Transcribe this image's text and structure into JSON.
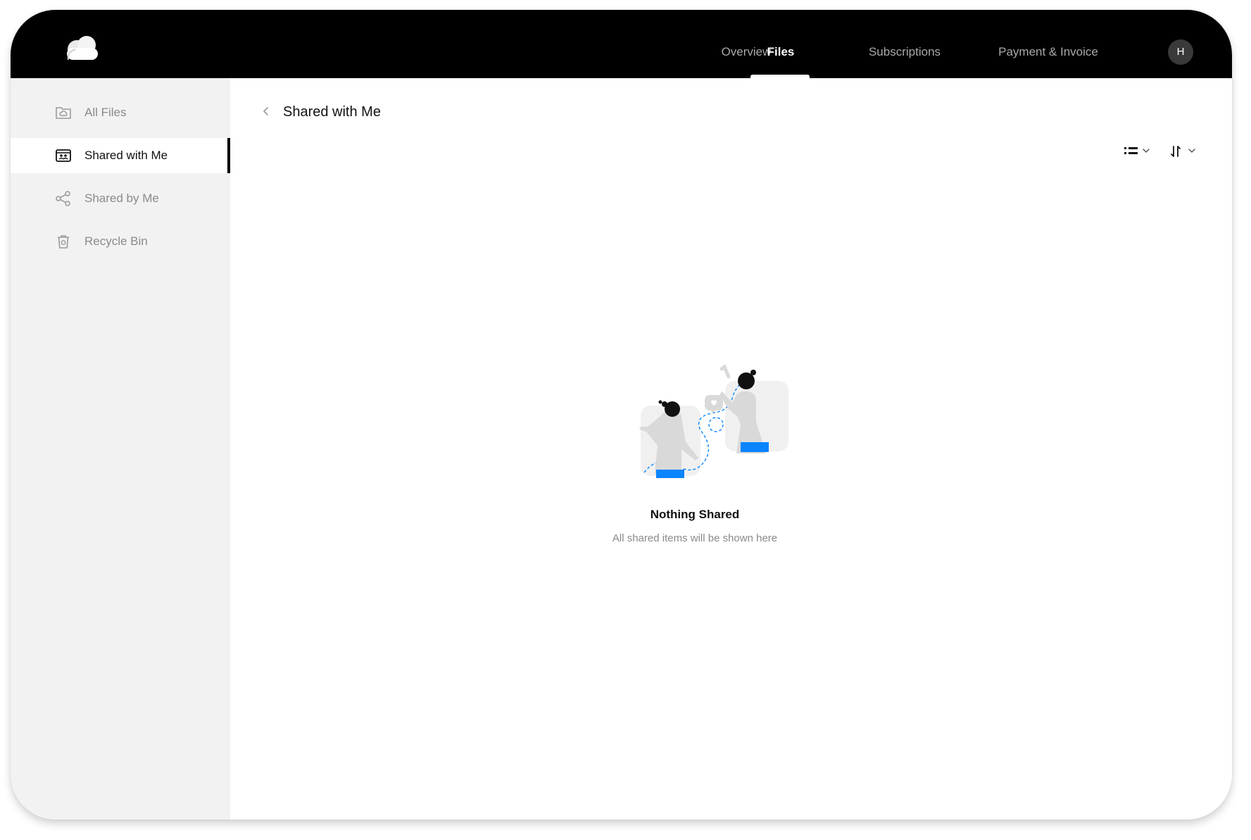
{
  "app": {
    "logo_icon": "cloud-icon"
  },
  "nav": {
    "tabs": [
      {
        "label": "Overview"
      },
      {
        "label": "Files"
      },
      {
        "label": "Subscriptions"
      },
      {
        "label": "Payment & Invoice"
      }
    ],
    "active_tab": "Files",
    "avatar_initial": "H"
  },
  "sidebar": {
    "items": [
      {
        "label": "All Files",
        "icon": "folder-cloud-icon"
      },
      {
        "label": "Shared with Me",
        "icon": "shared-with-me-icon"
      },
      {
        "label": "Shared by Me",
        "icon": "share-icon"
      },
      {
        "label": "Recycle Bin",
        "icon": "trash-icon"
      }
    ],
    "active_item": "Shared with Me"
  },
  "main": {
    "title": "Shared with Me",
    "back_icon": "chevron-left-icon",
    "view_toggle_icon": "list-view-icon",
    "sort_icon": "sort-icon",
    "empty_state": {
      "title": "Nothing Shared",
      "subtitle": "All shared items will be shown here",
      "illustration": "people-sharing-illustration"
    }
  },
  "colors": {
    "topbar": "#000000",
    "sidebar": "#f2f2f2",
    "accent_blue": "#0a84ff",
    "figure_gray": "#d9d9d9"
  }
}
